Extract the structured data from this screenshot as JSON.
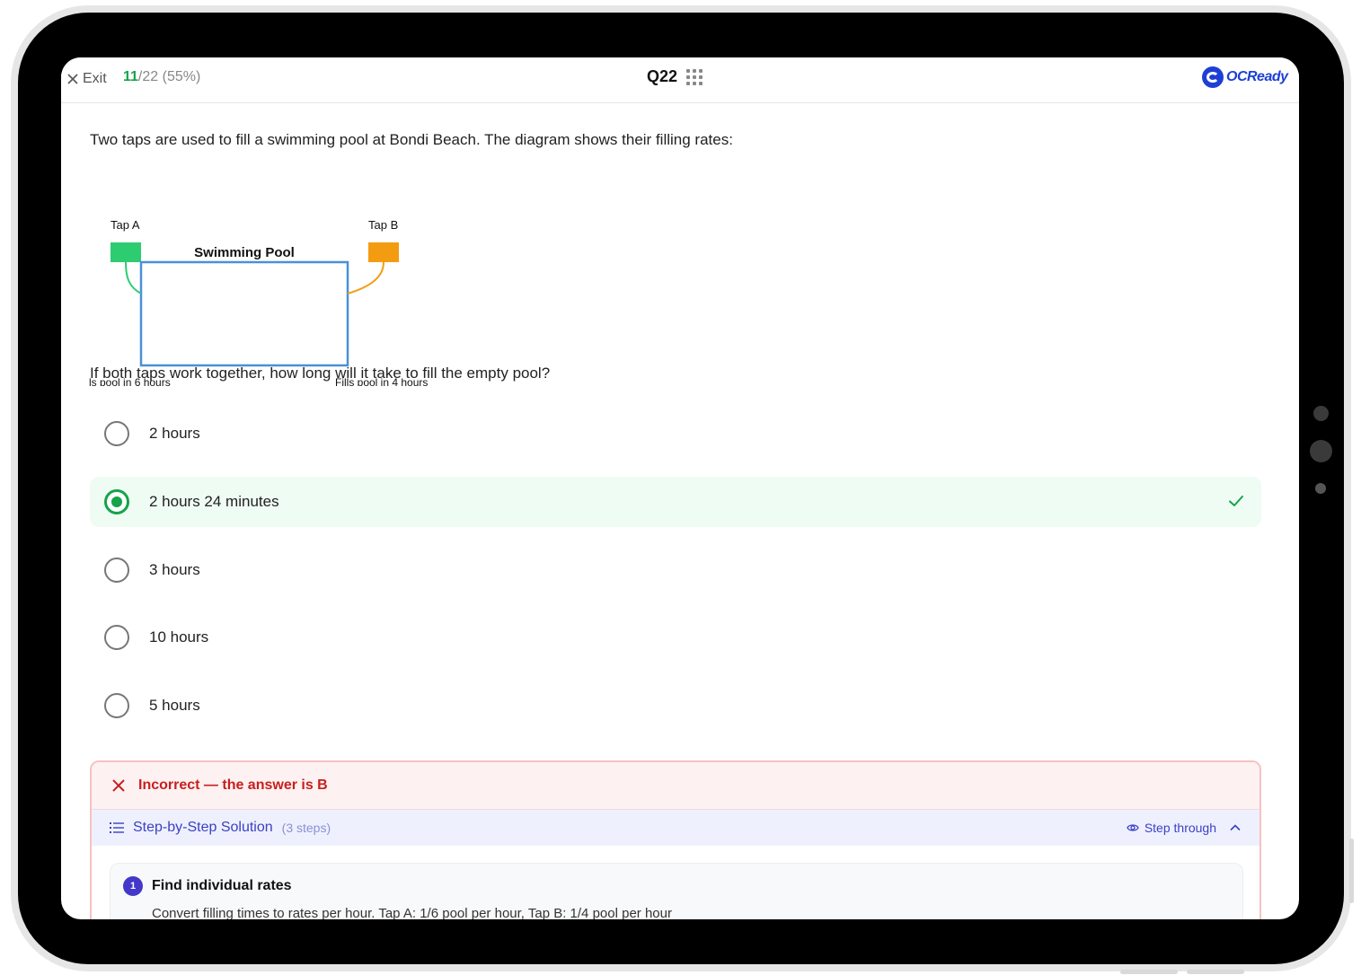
{
  "topbar": {
    "exit_label": "Exit",
    "progress_done": "11",
    "progress_rest": "/22 (55%)",
    "question_number": "Q22",
    "logo_text": "OCReady"
  },
  "question": {
    "intro": "Two taps are used to fill a swimming pool at Bondi Beach. The diagram shows their filling rates:",
    "prompt": "If both taps work together, how long will it take to fill the empty pool?"
  },
  "diagram": {
    "tap_a_label": "Tap A",
    "tap_b_label": "Tap B",
    "pool_label": "Swimming Pool",
    "tap_a_caption": "ls pool in 6 hours",
    "tap_b_caption": "Fills pool in 4 hours",
    "tap_a_color": "#2ecc71",
    "tap_b_color": "#f39c12",
    "pool_color": "#4a90d9"
  },
  "options": [
    {
      "label": "2 hours",
      "selected": false
    },
    {
      "label": "2 hours 24 minutes",
      "selected": true
    },
    {
      "label": "3 hours",
      "selected": false
    },
    {
      "label": "10 hours",
      "selected": false
    },
    {
      "label": "5 hours",
      "selected": false
    }
  ],
  "feedback": {
    "title": "Incorrect — the answer is B",
    "solution_title": "Step-by-Step Solution",
    "solution_steps": "(3 steps)",
    "step_through_label": "Step through",
    "steps": [
      {
        "number": "1",
        "title": "Find individual rates",
        "desc": "Convert filling times to rates per hour. Tap A: 1/6 pool per hour, Tap B: 1/4 pool per hour"
      }
    ]
  },
  "colors": {
    "correct_green": "#16a34a",
    "incorrect_red": "#c81e1e",
    "solution_indigo": "#3b3fc4"
  }
}
